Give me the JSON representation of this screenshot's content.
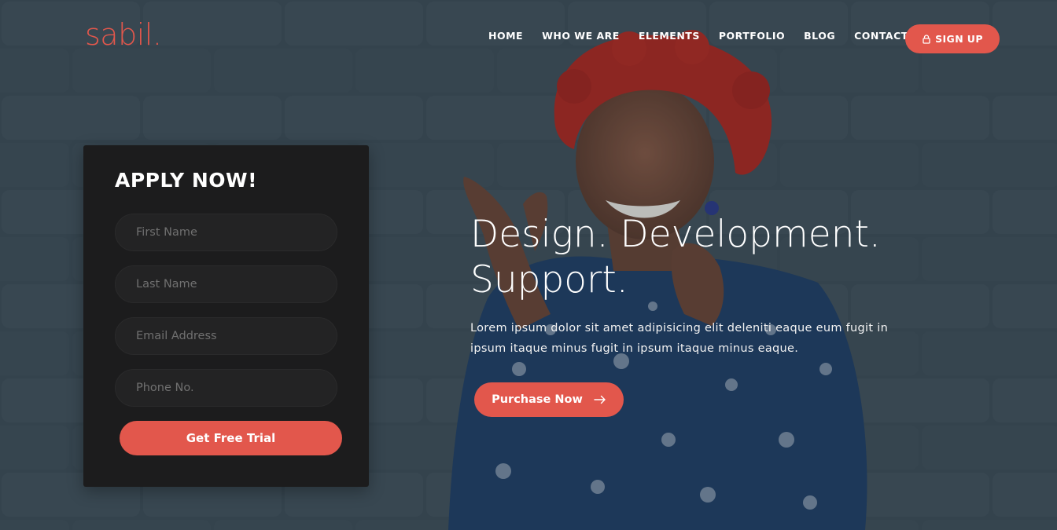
{
  "brand": {
    "logo": "sabil.",
    "accent_color": "#e2574c"
  },
  "nav": {
    "items": [
      "HOME",
      "WHO WE ARE",
      "ELEMENTS",
      "PORTFOLIO",
      "BLOG",
      "CONTACT"
    ],
    "signup_label": "SIGN UP",
    "signup_icon": "lock-icon"
  },
  "form": {
    "title": "APPLY NOW!",
    "fields": {
      "first_name": {
        "placeholder": "First Name",
        "value": ""
      },
      "last_name": {
        "placeholder": "Last Name",
        "value": ""
      },
      "email": {
        "placeholder": "Email Address",
        "value": ""
      },
      "phone": {
        "placeholder": "Phone No.",
        "value": ""
      }
    },
    "submit_label": "Get Free Trial"
  },
  "hero": {
    "title_line1": "Design. Development.",
    "title_line2": "Support.",
    "description": "Lorem ipsum dolor sit amet adipisicing elit deleniti eaque eum fugit in ipsum itaque minus fugit in ipsum itaque minus eaque.",
    "cta_label": "Purchase Now",
    "cta_icon": "arrow-right-icon"
  }
}
